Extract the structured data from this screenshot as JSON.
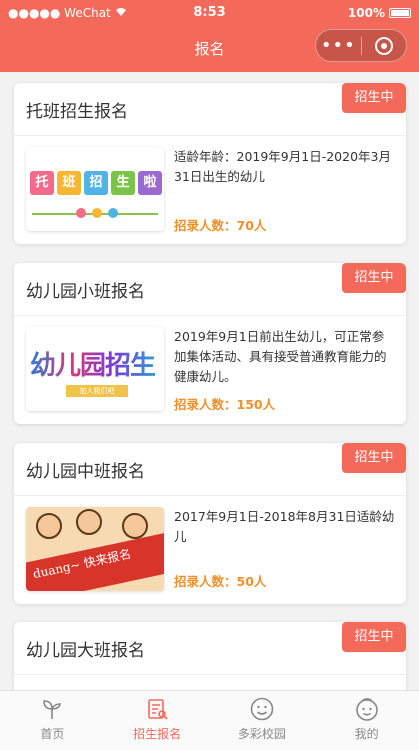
{
  "status_bar": {
    "carrier": "●●●●● WeChat",
    "time": "8:53",
    "battery": "100%"
  },
  "nav": {
    "title": "报名",
    "more_label": "•••"
  },
  "cards": [
    {
      "title": "托班招生报名",
      "badge": "招生中",
      "desc": "适龄年龄：2019年9月1日-2020年3月31日出生的幼儿",
      "count": "招录人数：70人",
      "thumb_text": [
        "托",
        "班",
        "招",
        "生",
        "啦"
      ]
    },
    {
      "title": "幼儿园小班报名",
      "badge": "招生中",
      "desc": "2019年9月1日前出生幼儿，可正常参加集体活动、具有接受普通教育能力的健康幼儿。",
      "count": "招录人数：150人",
      "thumb_text": "幼儿园招生",
      "thumb_sub": "加入我们吧"
    },
    {
      "title": "幼儿园中班报名",
      "badge": "招生中",
      "desc": "2017年9月1日-2018年8月31日适龄幼儿",
      "count": "招录人数：50人",
      "thumb_text": "duang~ 快来报名"
    },
    {
      "title": "幼儿园大班报名",
      "badge": "招生中"
    }
  ],
  "tabbar": [
    {
      "label": "首页",
      "icon": "sprout-icon"
    },
    {
      "label": "招生报名",
      "icon": "form-icon",
      "active": true
    },
    {
      "label": "多彩校园",
      "icon": "smile-face-icon"
    },
    {
      "label": "我的",
      "icon": "profile-face-icon"
    }
  ],
  "colors": {
    "accent": "#f36a5a",
    "count": "#f0902a"
  }
}
